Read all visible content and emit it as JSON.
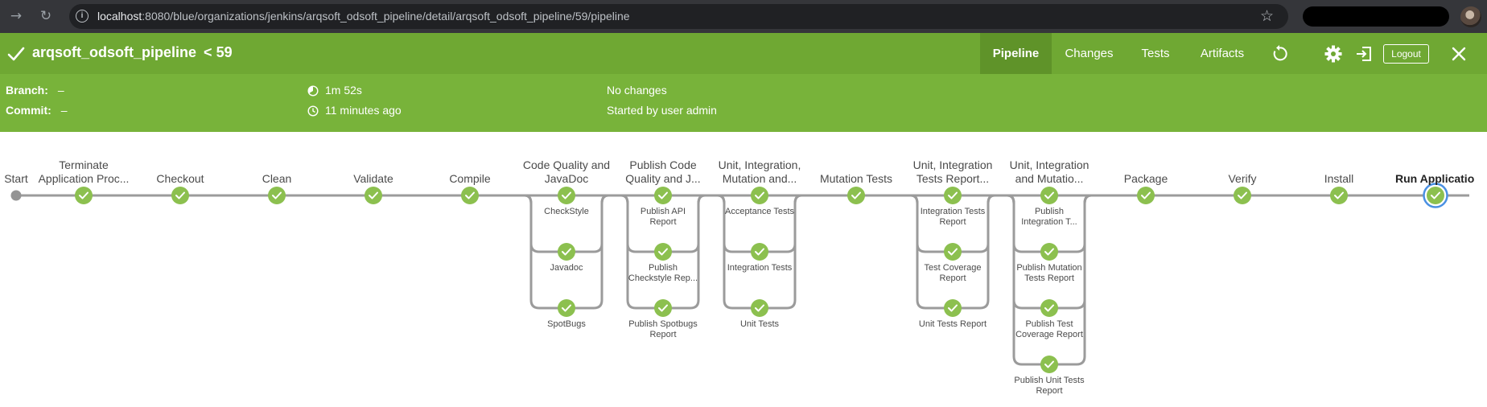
{
  "browser": {
    "url_host": "localhost",
    "url_rest": ":8080/blue/organizations/jenkins/arqsoft_odsoft_pipeline/detail/arqsoft_odsoft_pipeline/59/pipeline",
    "back_icon": "arrow-right-icon",
    "reload_icon": "reload-icon"
  },
  "header": {
    "pipeline_name": "arqsoft_odsoft_pipeline",
    "separator": "<",
    "run_number": "59",
    "tabs": [
      "Pipeline",
      "Changes",
      "Tests",
      "Artifacts"
    ],
    "logout_label": "Logout"
  },
  "summary": {
    "branch_label": "Branch:",
    "branch_value": "–",
    "commit_label": "Commit:",
    "commit_value": "–",
    "duration": "1m 52s",
    "time_ago": "11 minutes ago",
    "changes": "No changes",
    "started_by": "Started by user admin"
  },
  "colors": {
    "success": "#8cc04f",
    "header_green": "#6fa833",
    "subheader_green": "#78b33a",
    "active_tab": "#5f9329",
    "selected_ring": "#4a90e2"
  },
  "pipeline": {
    "start_label": "Start",
    "stages": [
      {
        "name": "Terminate Application Proc...",
        "lines": [
          "Terminate",
          "Application Proc..."
        ],
        "status": "success"
      },
      {
        "name": "Checkout",
        "lines": [
          "Checkout"
        ],
        "status": "success"
      },
      {
        "name": "Clean",
        "lines": [
          "Clean"
        ],
        "status": "success"
      },
      {
        "name": "Validate",
        "lines": [
          "Validate"
        ],
        "status": "success"
      },
      {
        "name": "Compile",
        "lines": [
          "Compile"
        ],
        "status": "success"
      },
      {
        "name": "Code Quality and JavaDoc",
        "lines": [
          "Code Quality and",
          "JavaDoc"
        ],
        "status": "success",
        "branches": [
          [
            "CheckStyle"
          ],
          [
            "Javadoc"
          ],
          [
            "SpotBugs"
          ]
        ]
      },
      {
        "name": "Publish Code Quality and J...",
        "lines": [
          "Publish Code",
          "Quality and J..."
        ],
        "status": "success",
        "branches": [
          [
            "Publish API",
            "Report"
          ],
          [
            "Publish",
            "Checkstyle Rep..."
          ],
          [
            "Publish Spotbugs",
            "Report"
          ]
        ]
      },
      {
        "name": "Unit, Integration, Mutation and...",
        "lines": [
          "Unit, Integration,",
          "Mutation and..."
        ],
        "status": "success",
        "branches": [
          [
            "Acceptance Tests"
          ],
          [
            "Integration Tests"
          ],
          [
            "Unit Tests"
          ]
        ]
      },
      {
        "name": "Mutation Tests",
        "lines": [
          "Mutation Tests"
        ],
        "status": "success"
      },
      {
        "name": "Unit, Integration Tests Report...",
        "lines": [
          "Unit, Integration",
          "Tests Report..."
        ],
        "status": "success",
        "branches": [
          [
            "Integration Tests",
            "Report"
          ],
          [
            "Test Coverage",
            "Report"
          ],
          [
            "Unit Tests Report"
          ]
        ]
      },
      {
        "name": "Unit, Integration and Mutatio...",
        "lines": [
          "Unit, Integration",
          "and Mutatio..."
        ],
        "status": "success",
        "branches": [
          [
            "Publish",
            "Integration T..."
          ],
          [
            "Publish Mutation",
            "Tests Report"
          ],
          [
            "Publish Test",
            "Coverage Report"
          ],
          [
            "Publish Unit Tests",
            "Report"
          ]
        ]
      },
      {
        "name": "Package",
        "lines": [
          "Package"
        ],
        "status": "success"
      },
      {
        "name": "Verify",
        "lines": [
          "Verify"
        ],
        "status": "success"
      },
      {
        "name": "Install",
        "lines": [
          "Install"
        ],
        "status": "success"
      },
      {
        "name": "Run Applicatio",
        "lines": [
          "Run Applicatio"
        ],
        "status": "success",
        "selected": true
      }
    ]
  }
}
